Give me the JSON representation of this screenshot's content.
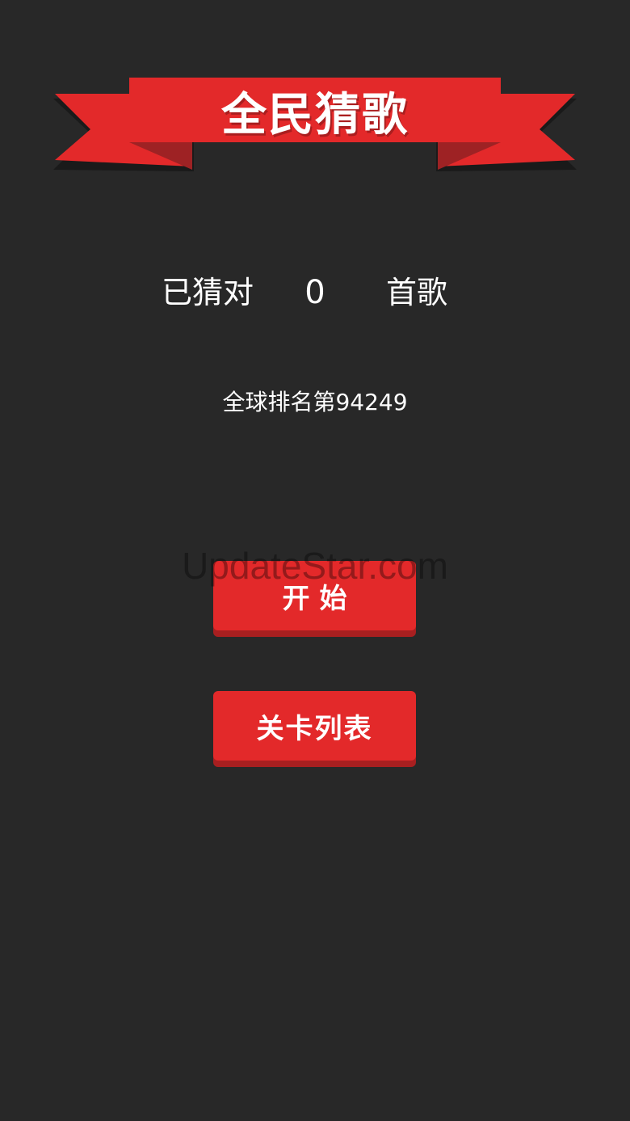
{
  "banner": {
    "title": "全民猜歌",
    "ribbon_color": "#e3292a",
    "ribbon_fold_color": "#9e2224"
  },
  "stats": {
    "prefix": "已猜对",
    "count": "0",
    "suffix": "首歌",
    "rank": "全球排名第94249"
  },
  "buttons": {
    "start_label": "开始",
    "levels_label": "关卡列表"
  },
  "watermark": "UpdateStar.com",
  "colors": {
    "background": "#282828",
    "button": "#e3292a",
    "button_shadow": "#a81f20",
    "text": "#ffffff"
  }
}
